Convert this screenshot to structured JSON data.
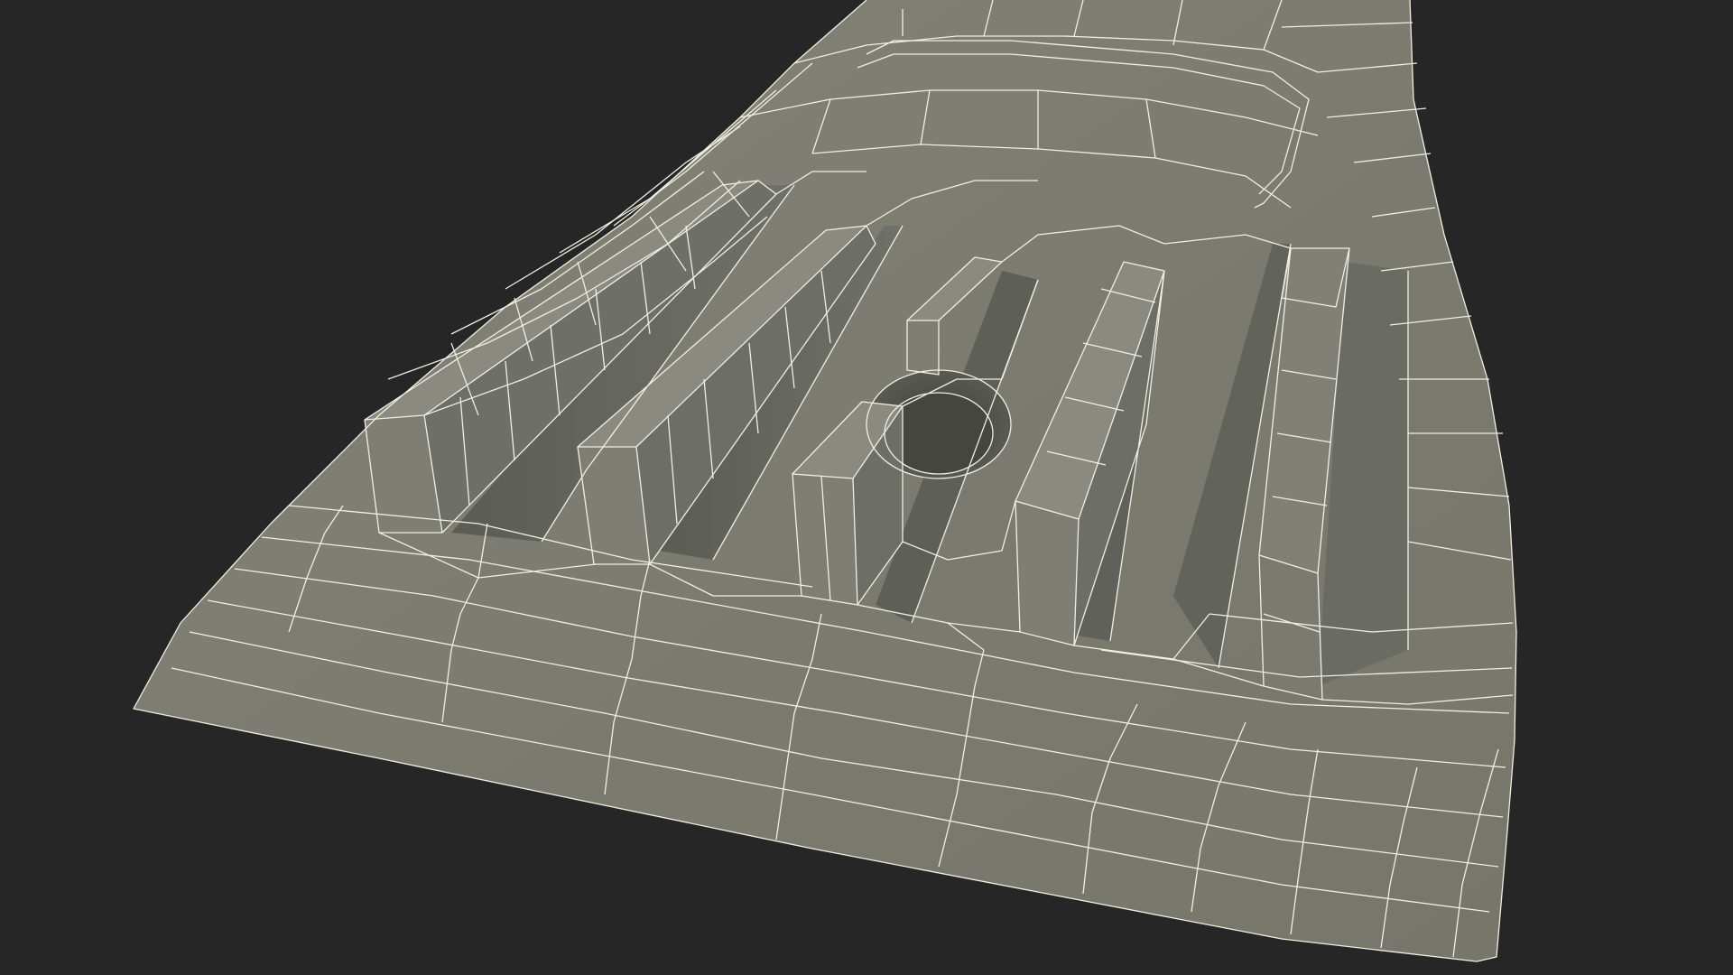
{
  "viewport": {
    "background_color": "#262626",
    "surface_color": "#7b7b6f",
    "wire_color": "#efefe2",
    "shadow_color": "#56574e",
    "deep_shadow_color": "#474840",
    "render_mode": "shaded-wireframe",
    "subject": "3d-mesh-surface-with-ribs-and-hole"
  }
}
